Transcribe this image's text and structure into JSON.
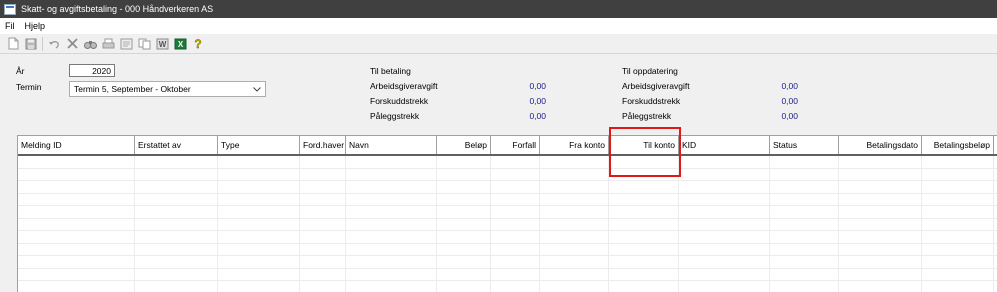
{
  "window": {
    "title": "Skatt- og avgiftsbetaling - 000 Håndverkeren AS"
  },
  "menu": {
    "items": [
      "Fil",
      "Hjelp"
    ]
  },
  "toolbar": {
    "tools": [
      "new-document-icon",
      "save-icon",
      "undo-icon",
      "delete-icon",
      "find-icon",
      "print-icon",
      "print-preview-icon",
      "copy-icon",
      "word-icon",
      "excel-icon",
      "help-icon"
    ]
  },
  "form": {
    "year_label": "År",
    "year_value": "2020",
    "termin_label": "Termin",
    "termin_value": "Termin 5, September - Oktober"
  },
  "til_betaling": {
    "title": "Til betaling",
    "rows": [
      {
        "label": "Arbeidsgiveravgift",
        "value": "0,00"
      },
      {
        "label": "Forskuddstrekk",
        "value": "0,00"
      },
      {
        "label": "Påleggstrekk",
        "value": "0,00"
      }
    ]
  },
  "til_oppdatering": {
    "title": "Til oppdatering",
    "rows": [
      {
        "label": "Arbeidsgiveravgift",
        "value": "0,00"
      },
      {
        "label": "Forskuddstrekk",
        "value": "0,00"
      },
      {
        "label": "Påleggstrekk",
        "value": "0,00"
      }
    ]
  },
  "grid": {
    "columns": [
      "Melding ID",
      "Erstattet av",
      "Type",
      "Ford.haver",
      "Navn",
      "Beløp",
      "Forfall",
      "Fra konto",
      "Til konto",
      "KID",
      "Status",
      "Betalingsdato",
      "Betalingsbeløp"
    ]
  },
  "colors": {
    "titlebar": "#404040",
    "highlight": "#e01818",
    "value_text": "#1a1a8c"
  }
}
